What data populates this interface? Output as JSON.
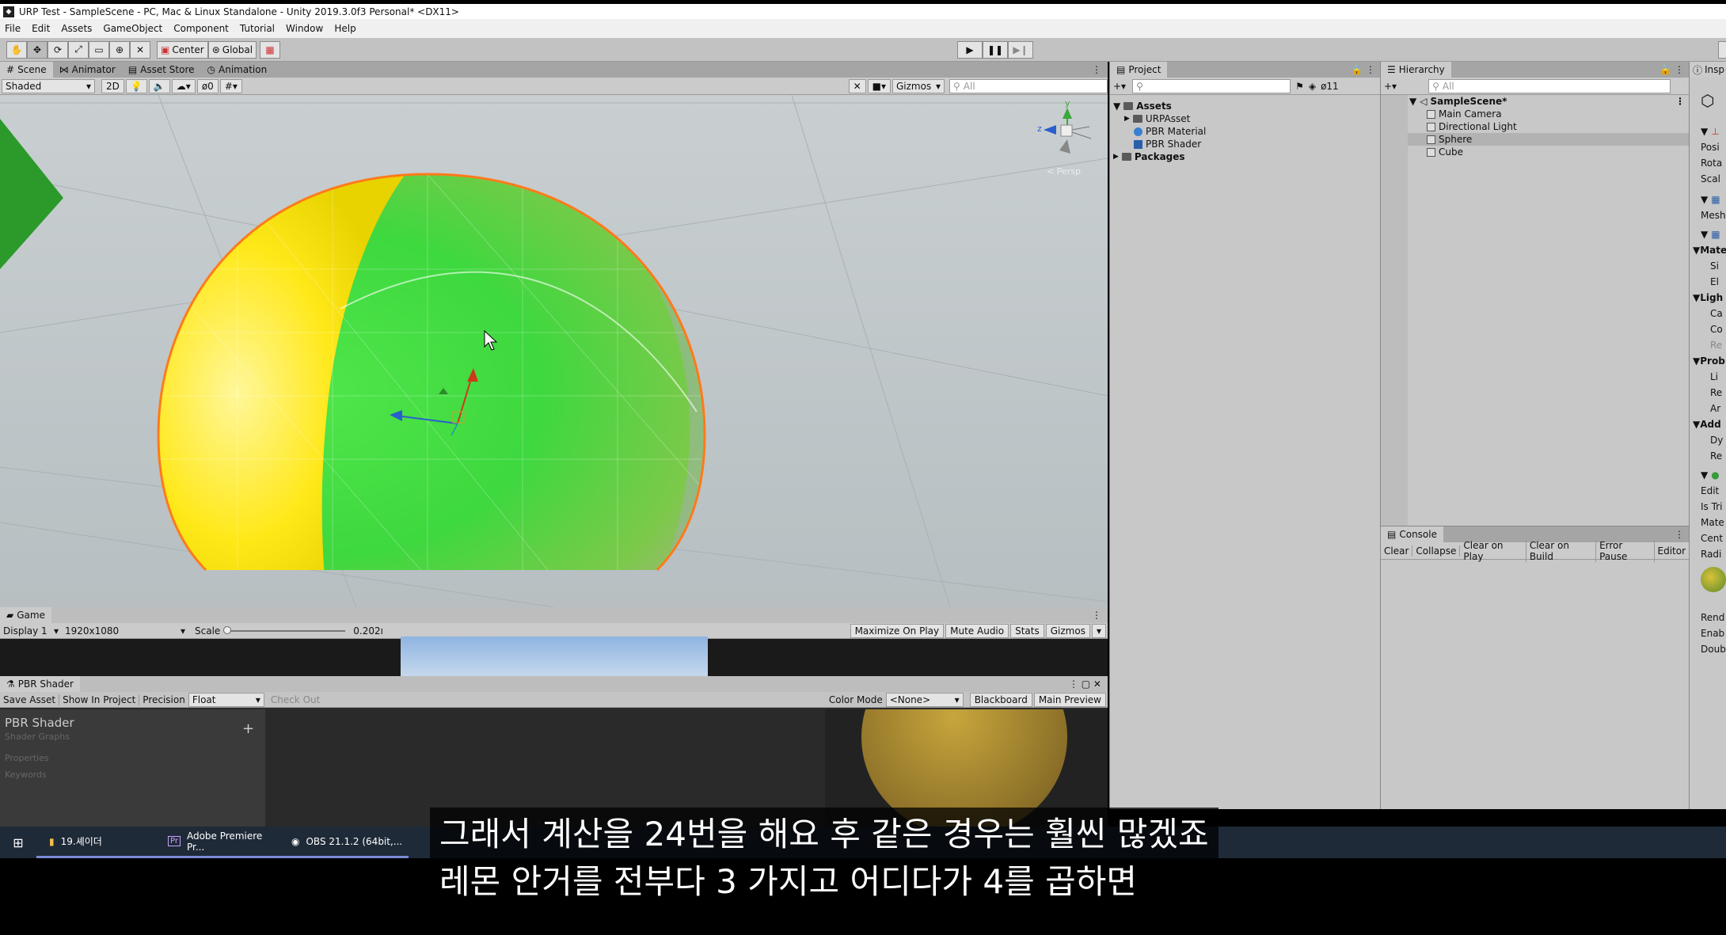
{
  "window": {
    "title": "URP Test - SampleScene - PC, Mac & Linux Standalone - Unity 2019.3.0f3 Personal* <DX11>"
  },
  "menu": [
    "File",
    "Edit",
    "Assets",
    "GameObject",
    "Component",
    "Tutorial",
    "Window",
    "Help"
  ],
  "toolbar": {
    "center_label": "Center",
    "global_label": "Global"
  },
  "scene": {
    "tabs": [
      "Scene",
      "Animator",
      "Asset Store",
      "Animation"
    ],
    "shading": "Shaded",
    "mode_2d": "2D",
    "hidden_count": "0",
    "gizmos_label": "Gizmos",
    "search_placeholder": "All",
    "persp_label": "< Persp",
    "axis_y": "y",
    "axis_z": "z"
  },
  "game": {
    "tab": "Game",
    "display": "Display 1",
    "resolution": "1920x1080",
    "scale_label": "Scale",
    "scale_value": "0.202ı",
    "buttons": [
      "Maximize On Play",
      "Mute Audio",
      "Stats",
      "Gizmos"
    ]
  },
  "shader_graph": {
    "tab": "PBR Shader",
    "toolbar": {
      "save": "Save Asset",
      "show": "Show In Project",
      "precision_label": "Precision",
      "precision_value": "Float",
      "checkout": "Check Out",
      "color_mode_label": "Color Mode",
      "color_mode_value": "<None>",
      "blackboard": "Blackboard",
      "main_preview": "Main Preview"
    },
    "title": "PBR Shader",
    "subtitle": "Shader Graphs",
    "properties": "Properties",
    "keywords": "Keywords",
    "add": "+"
  },
  "project": {
    "tab": "Project",
    "hidden_count": "11",
    "items": [
      {
        "label": "Assets",
        "type": "folder"
      },
      {
        "label": "URPAsset",
        "type": "folder"
      },
      {
        "label": "PBR Material",
        "type": "material"
      },
      {
        "label": "PBR Shader",
        "type": "shader"
      },
      {
        "label": "Packages",
        "type": "folder"
      }
    ]
  },
  "hierarchy": {
    "tab": "Hierarchy",
    "search_placeholder": "All",
    "scene": "SampleScene*",
    "items": [
      "Main Camera",
      "Directional Light",
      "Sphere",
      "Cube"
    ],
    "selected": "Sphere"
  },
  "console": {
    "tab": "Console",
    "buttons": [
      "Clear",
      "Collapse",
      "Clear on Play",
      "Clear on Build",
      "Error Pause",
      "Editor"
    ]
  },
  "inspector": {
    "tab": "Insp",
    "rows": [
      "Posi",
      "Rota",
      "Scal",
      "Mesh",
      "Mate",
      "Si",
      "El",
      "Ligh",
      "Ca",
      "Co",
      "Re",
      "Prob",
      "Li",
      "Re",
      "Ar",
      "Add",
      "Dy",
      "Re",
      "Edit",
      "Is Tri",
      "Mate",
      "Cent",
      "Radi",
      "Rend",
      "Enab",
      "Doub"
    ]
  },
  "taskbar": {
    "items": [
      "19.셰이더",
      "Adobe Premiere Pr...",
      "OBS 21.1.2 (64bit,..."
    ]
  },
  "subtitles": {
    "line1": "그래서 계산을 24번을 해요 후 같은 경우는 훨씬 많겠죠",
    "line2": "레몬 안거를 전부다 3 가지고 어디다가 4를 곱하면"
  }
}
